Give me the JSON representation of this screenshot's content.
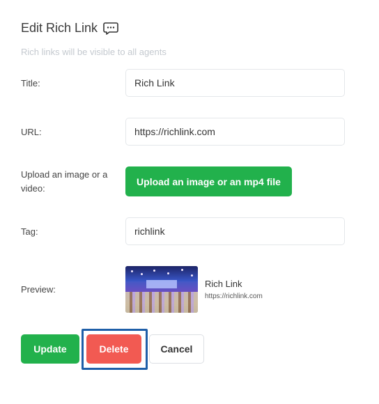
{
  "header": {
    "title": "Edit Rich Link",
    "icon": "chat-icon",
    "subtitle": "Rich links will be visible to all agents"
  },
  "form": {
    "title_label": "Title:",
    "title_value": "Rich Link",
    "url_label": "URL:",
    "url_value": "https://richlink.com",
    "upload_label": "Upload an image or a video:",
    "upload_button": "Upload an image or an mp4 file",
    "tag_label": "Tag:",
    "tag_value": "richlink",
    "preview_label": "Preview:"
  },
  "preview": {
    "title": "Rich Link",
    "url": "https://richlink.com"
  },
  "actions": {
    "update": "Update",
    "delete": "Delete",
    "cancel": "Cancel"
  },
  "colors": {
    "primary_green": "#22b14c",
    "delete_red": "#f25a52",
    "focus_blue": "#1f5fa8"
  }
}
